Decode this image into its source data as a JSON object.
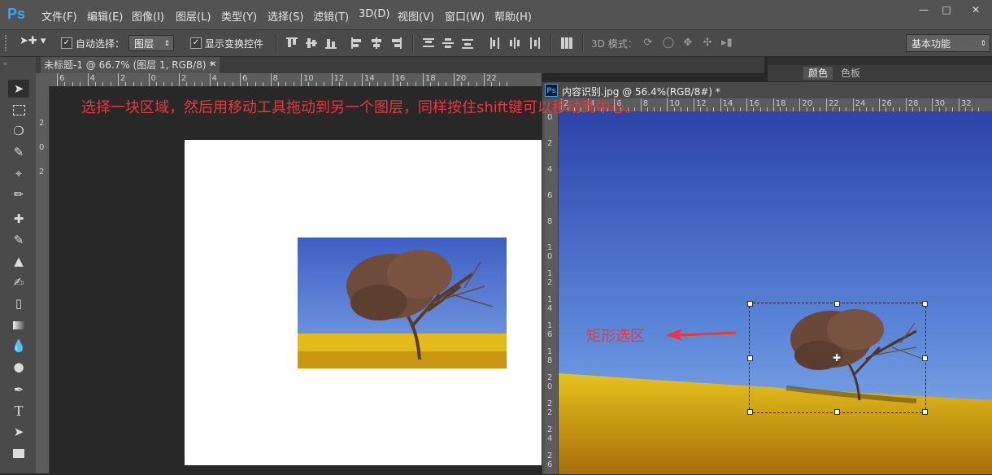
{
  "app": {
    "logo": "Ps"
  },
  "menu": [
    "文件(F)",
    "编辑(E)",
    "图像(I)",
    "图层(L)",
    "类型(Y)",
    "选择(S)",
    "滤镜(T)",
    "3D(D)",
    "视图(V)",
    "窗口(W)",
    "帮助(H)"
  ],
  "options": {
    "auto_select_label": "自动选择：",
    "auto_select_value": "图层",
    "show_transform_label": "显示变换控件",
    "mode3d_label": "3D 模式：",
    "workspace": "基本功能"
  },
  "doc1": {
    "tab_title": "未标题-1 @ 66.7% (图层 1, RGB/8) *",
    "ruler_labels": [
      "6",
      "4",
      "2",
      "0",
      "2",
      "4",
      "6",
      "8",
      "10",
      "12",
      "14",
      "16",
      "18",
      "20",
      "22"
    ]
  },
  "doc2": {
    "title": "内容识别.jpg @ 56.4%(RGB/8#) *",
    "ruler_labels": [
      "2",
      "4",
      "6",
      "8",
      "10",
      "12",
      "14",
      "16",
      "18",
      "20",
      "22",
      "24",
      "26",
      "28",
      "30",
      "32"
    ],
    "vruler_labels": [
      "0",
      "2",
      "4",
      "6",
      "8",
      "10",
      "12",
      "14",
      "16",
      "18",
      "20",
      "22",
      "24",
      "26"
    ]
  },
  "panels": {
    "tab_color": "颜色",
    "tab_swatches": "色板"
  },
  "annotations": {
    "main": "选择一块区域，然后用移动工具拖动到另一个图层，同样按住shift键可以移动到中心。",
    "marquee": "矩形选区"
  },
  "colors": {
    "accent": "#e8383c",
    "ps_blue": "#31a8ff"
  }
}
